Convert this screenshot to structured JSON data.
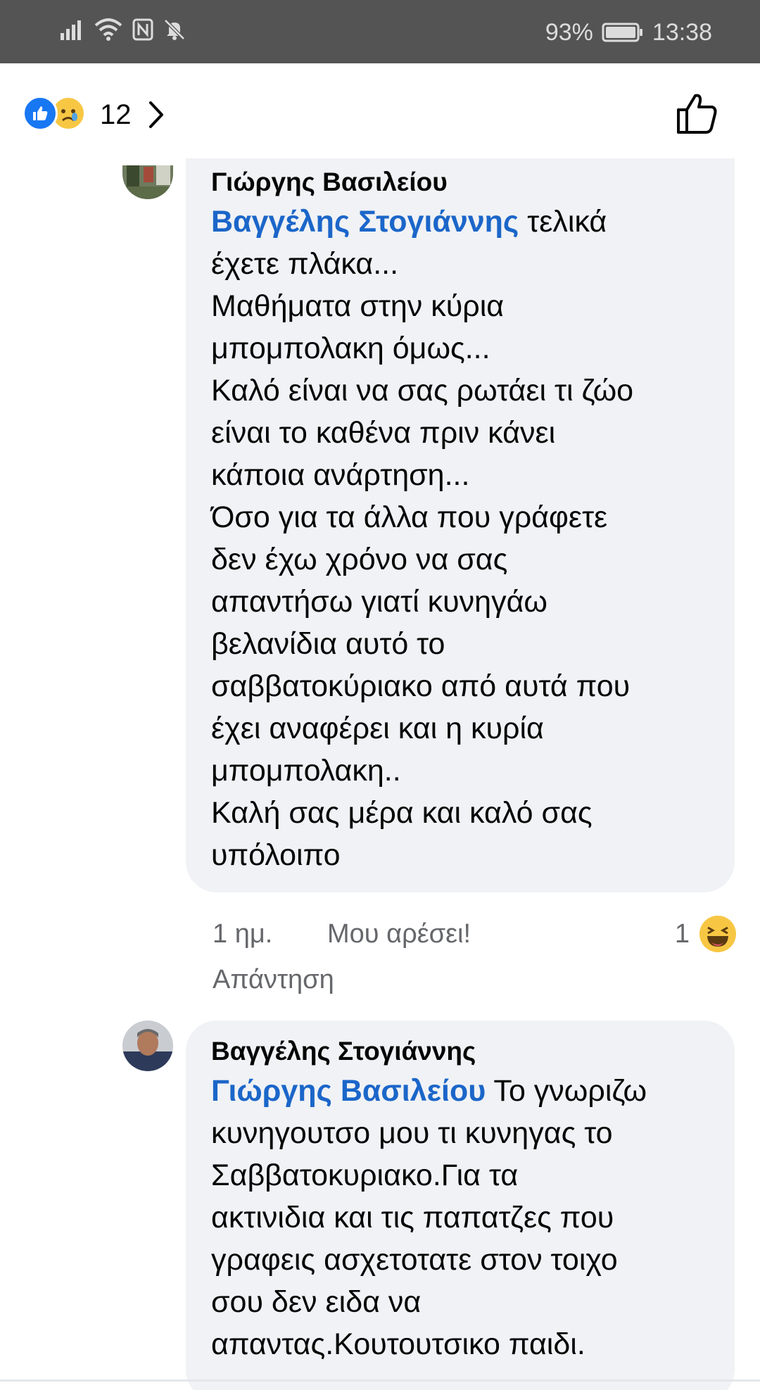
{
  "status_bar": {
    "battery": "93%",
    "time": "13:38",
    "icons": [
      "signal-icon",
      "wifi-icon",
      "nfc-icon",
      "mute-icon",
      "battery-icon"
    ]
  },
  "reactions": {
    "icons": [
      "like-icon",
      "sad-icon"
    ],
    "count": "12"
  },
  "comments": [
    {
      "author": "Γιώργης Βασιλείου",
      "mention": "Βαγγέλης Στογιάννης",
      "text": " τελικά\nέχετε πλάκα...\nΜαθήματα στην κύρια\nμπομπολακη όμως...\nΚαλό είναι να σας ρωτάει τι ζώο\nείναι το καθένα πριν κάνει\nκάποια ανάρτηση...\nΌσο για τα άλλα που γράφετε\nδεν έχω χρόνο να σας\nαπαντήσω γιατί κυνηγάω\nβελανίδια αυτό το\nσαββατοκύριακο από αυτά που\nέχει αναφέρει και η κυρία\nμπομπολακη..\nΚαλή σας μέρα και καλό σας\nυπόλοιπο",
      "time": "1 ημ.",
      "like_label": "Μου αρέσει!",
      "reply_label": "Απάντηση",
      "reaction_count": "1"
    },
    {
      "author": "Βαγγέλης Στογιάννης",
      "mention": "Γιώργης Βασιλείου",
      "text": " Το γνωριζω\nκυνηγουτσο μου τι κυνηγας το\nΣαββατοκυριακο.Για τα\nακτινιδια και τις παπατζες που\nγραφεις ασχετοτατε στον τοιχο\nσου δεν ειδα να\nαπαντας.Κουτουτσικο παιδι."
    }
  ]
}
